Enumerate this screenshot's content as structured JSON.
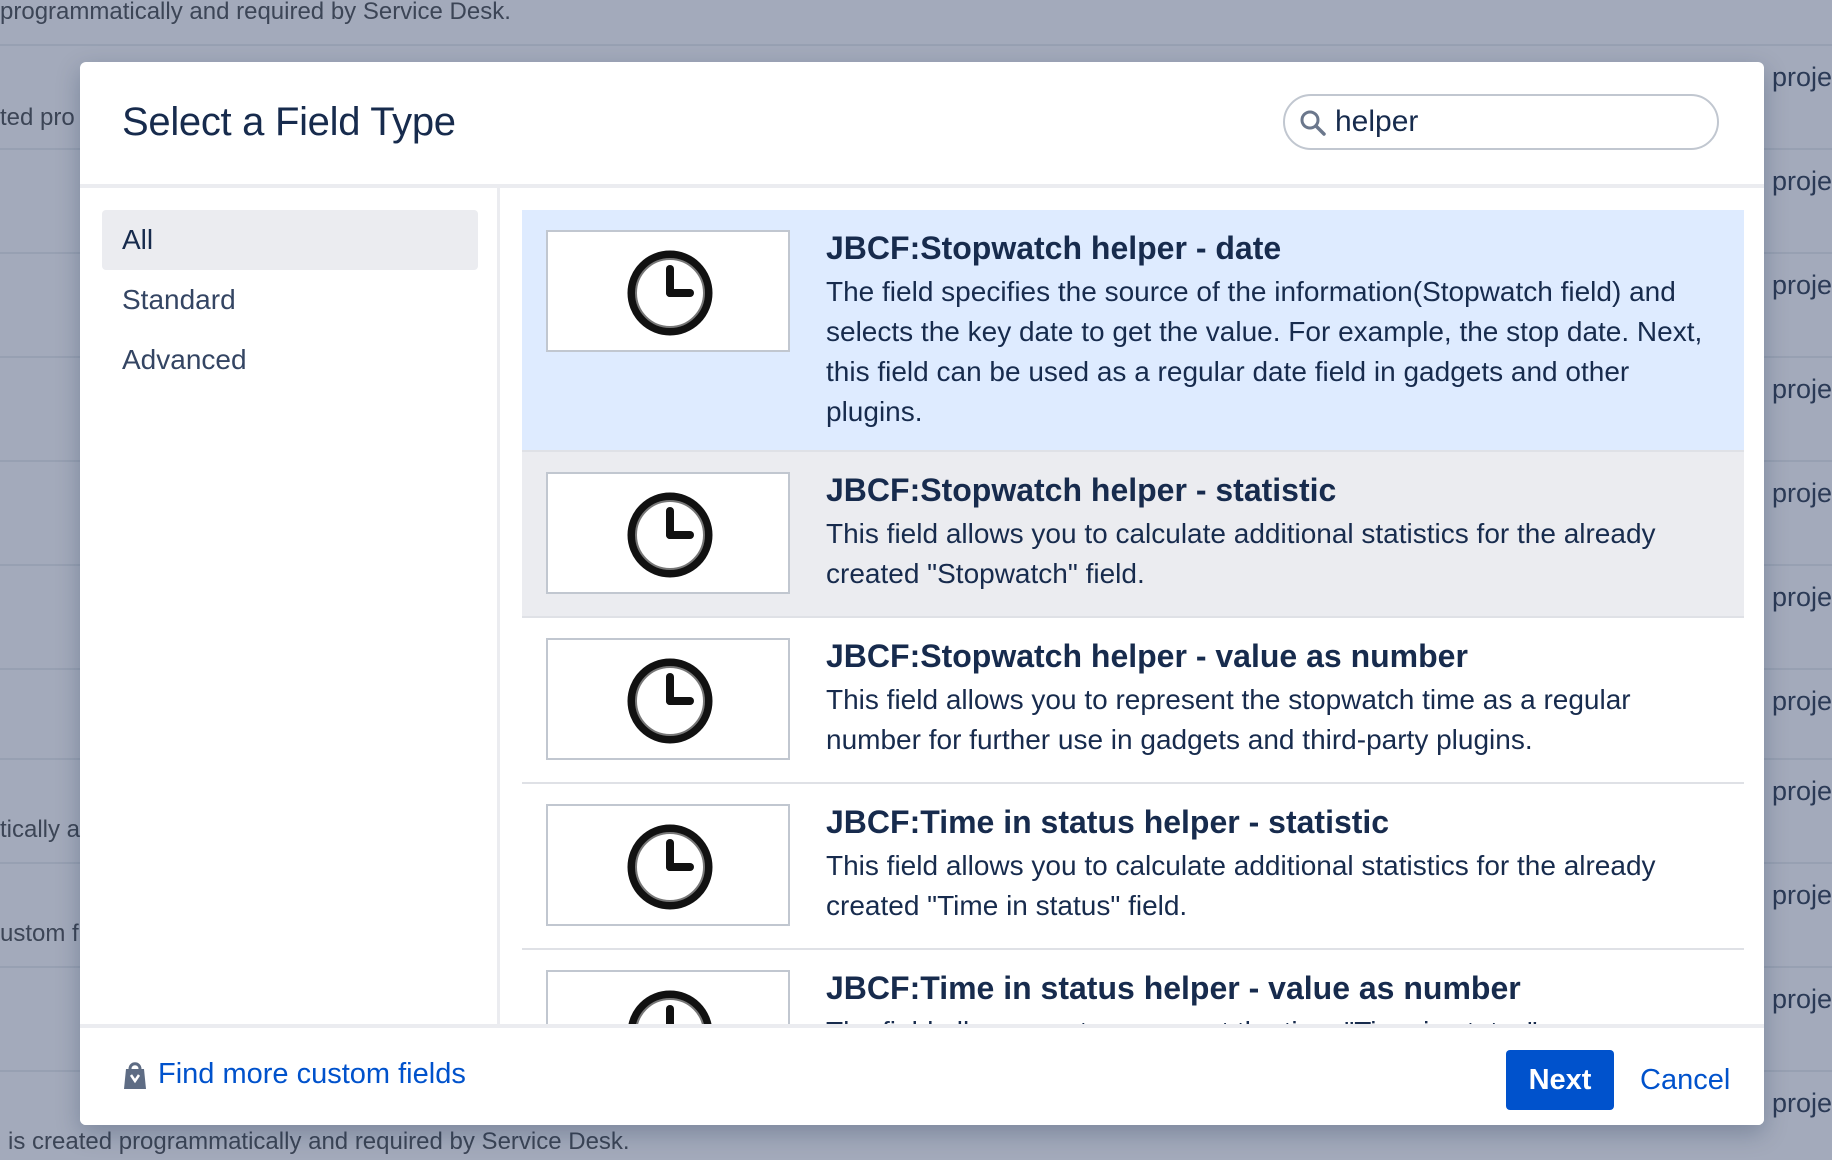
{
  "background": {
    "top_text": "programmatically and required by Service Desk.",
    "bottom_text": "is created programmatically and required by Service Desk.",
    "left_fragments": [
      "ted pro",
      "tically a",
      "ustom f"
    ],
    "right_fragment": "proje"
  },
  "dialog": {
    "title": "Select a Field Type",
    "search": {
      "value": "helper",
      "placeholder": "Search"
    },
    "categories": [
      {
        "label": "All",
        "active": true
      },
      {
        "label": "Standard",
        "active": false
      },
      {
        "label": "Advanced",
        "active": false
      }
    ],
    "fields": [
      {
        "title": "JBCF:Stopwatch helper - date",
        "description": "The field specifies the source of the information(Stopwatch field) and selects the key date to get the value. For example, the stop date. Next, this field can be used as a regular date field in gadgets and other plugins.",
        "icon": "clock-icon",
        "state": "selected"
      },
      {
        "title": "JBCF:Stopwatch helper - statistic",
        "description": "This field allows you to calculate additional statistics for the already created \"Stopwatch\" field.",
        "icon": "clock-icon",
        "state": "hovered"
      },
      {
        "title": "JBCF:Stopwatch helper - value as number",
        "description": "This field allows you to represent the stopwatch time as a regular number for further use in gadgets and third-party plugins.",
        "icon": "clock-icon",
        "state": "normal"
      },
      {
        "title": "JBCF:Time in status helper - statistic",
        "description": "This field allows you to calculate additional statistics for the already created \"Time in status\" field.",
        "icon": "clock-icon",
        "state": "normal"
      },
      {
        "title": "JBCF:Time in status helper - value as number",
        "description": "The field allows you to represent the time \"Time in status\"",
        "icon": "clock-icon",
        "state": "normal"
      }
    ],
    "footer": {
      "more_link": "Find more custom fields",
      "next_label": "Next",
      "cancel_label": "Cancel"
    }
  },
  "colors": {
    "accent": "#0052cc",
    "selected_row": "#deebff",
    "hover_row": "#ebecf0",
    "overlay": "#a4abbb"
  }
}
